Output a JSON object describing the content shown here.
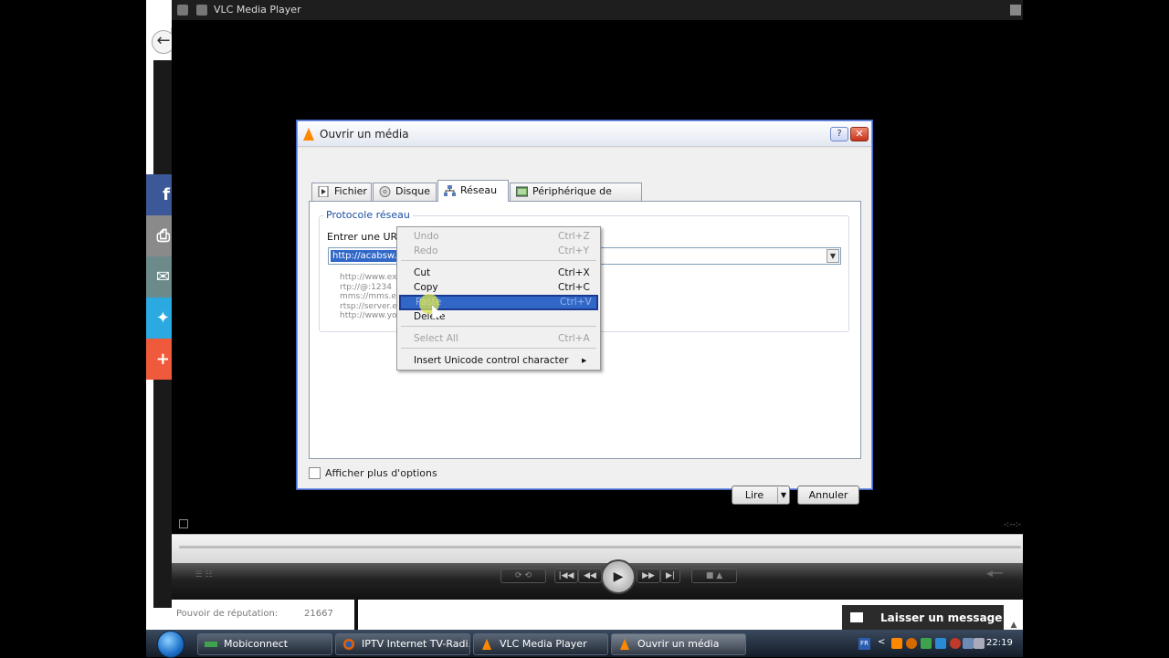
{
  "vlc": {
    "title": "VLC Media Player",
    "time_display": "-:--:-"
  },
  "share": {
    "facebook": "f",
    "plus": "+"
  },
  "dialog": {
    "title": "Ouvrir un média",
    "help": "?",
    "close": "✕",
    "tabs": {
      "fichier": "Fichier",
      "disque": "Disque",
      "reseau": "Réseau",
      "capture": "Périphérique de capture"
    },
    "group_label": "Protocole réseau",
    "url_label": "Entrer une URL réseau :",
    "url_value": "http://acabsw.d",
    "examples": [
      "http://www.exa",
      "rtp://@:1234",
      "mms://mms.exa",
      "rtsp://server.exa",
      "http://www.you"
    ],
    "more_options": "Afficher plus d'options",
    "btn_lire": "Lire",
    "btn_annuler": "Annuler"
  },
  "context_menu": {
    "undo": {
      "label": "Undo",
      "shortcut": "Ctrl+Z"
    },
    "redo": {
      "label": "Redo",
      "shortcut": "Ctrl+Y"
    },
    "cut": {
      "label": "Cut",
      "shortcut": "Ctrl+X"
    },
    "copy": {
      "label": "Copy",
      "shortcut": "Ctrl+C"
    },
    "paste": {
      "label": "Paste",
      "shortcut": "Ctrl+V"
    },
    "delete": {
      "label": "Delete"
    },
    "select_all": {
      "label": "Select All",
      "shortcut": "Ctrl+A"
    },
    "insert_unicode": {
      "label": "Insert Unicode control character",
      "arrow": "▸"
    }
  },
  "web": {
    "reputation_label": "Pouvoir de réputation:",
    "reputation_value": "21667",
    "message_button": "Laisser un message"
  },
  "taskbar": {
    "items": [
      "Mobiconnect",
      "IPTV Internet TV-Radi...",
      "VLC Media Player",
      "Ouvrir un média"
    ],
    "lang": "FR",
    "clock": "22:19"
  },
  "colors": {
    "selection": "#3168c8",
    "vlc_orange": "#ff8800",
    "facebook": "#3b5998",
    "twitter": "#2ba9e1"
  }
}
